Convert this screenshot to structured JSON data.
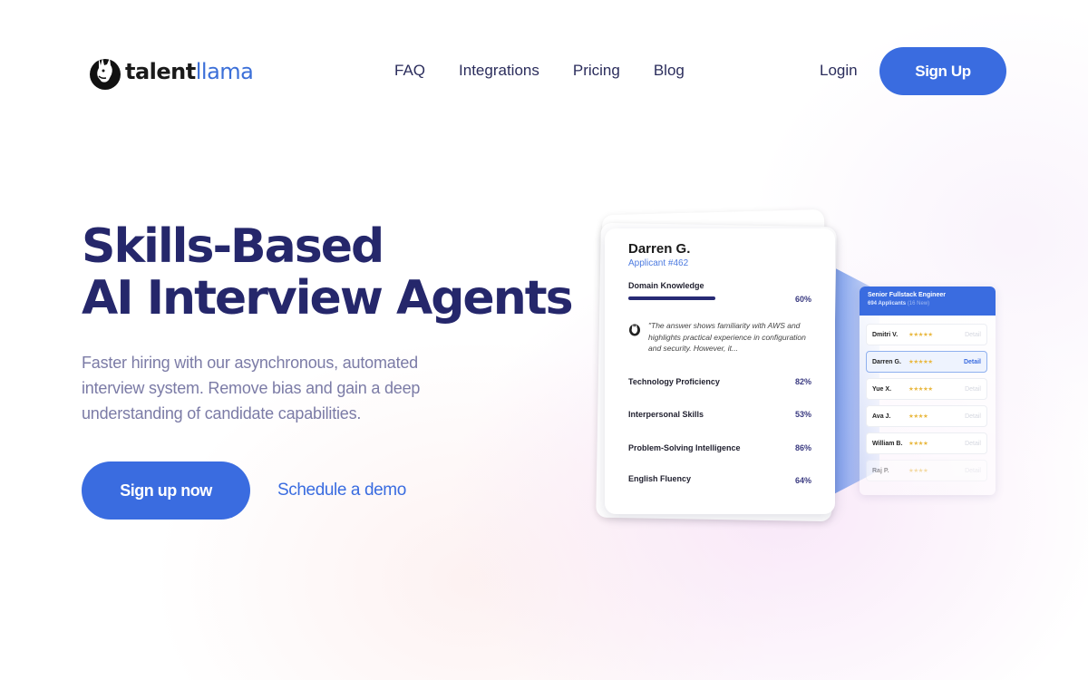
{
  "brand": {
    "name_part1": "talent",
    "name_part2": "llama",
    "accent_color": "#3a6ce0",
    "heading_color": "#25276b"
  },
  "nav": {
    "links": [
      "FAQ",
      "Integrations",
      "Pricing",
      "Blog"
    ],
    "login_label": "Login",
    "signup_label": "Sign Up"
  },
  "hero": {
    "title_line1": "Skills-Based",
    "title_line2": "AI Interview Agents",
    "subtitle": "Faster hiring with our asynchronous, automated interview system. Remove bias and gain a deep understanding of candidate capabilities.",
    "cta_primary": "Sign up now",
    "cta_secondary": "Schedule a demo"
  },
  "candidate_card": {
    "name": "Darren G.",
    "applicant_id": "Applicant #462",
    "skills": [
      {
        "label": "Domain Knowledge",
        "percent_text": "60%",
        "percent": 60
      },
      {
        "label": "Technology Proficiency",
        "percent_text": "82%",
        "percent": 82
      },
      {
        "label": "Interpersonal Skills",
        "percent_text": "53%",
        "percent": 53
      },
      {
        "label": "Problem-Solving Intelligence",
        "percent_text": "86%",
        "percent": 86
      },
      {
        "label": "English Fluency",
        "percent_text": "64%",
        "percent": 64
      }
    ],
    "quote": "\"The answer shows familiarity with AWS and highlights practical experience in configuration and security. However, it..."
  },
  "applicants_panel": {
    "title": "Senior Fullstack Engineer",
    "count": "694 Applicants",
    "new_count": "(16 New)",
    "detail_label": "Detail",
    "rows": [
      {
        "name": "Dmitri V.",
        "stars": "★★★★★",
        "rating": 5,
        "selected": false
      },
      {
        "name": "Darren G.",
        "stars": "★★★★★",
        "rating": 4.5,
        "selected": true
      },
      {
        "name": "Yue X.",
        "stars": "★★★★★",
        "rating": 4.5,
        "selected": false
      },
      {
        "name": "Ava J.",
        "stars": "★★★★",
        "rating": 4,
        "selected": false
      },
      {
        "name": "William B.",
        "stars": "★★★★",
        "rating": 4,
        "selected": false
      },
      {
        "name": "Raj P.",
        "stars": "★★★★",
        "rating": 4,
        "selected": false
      }
    ]
  }
}
